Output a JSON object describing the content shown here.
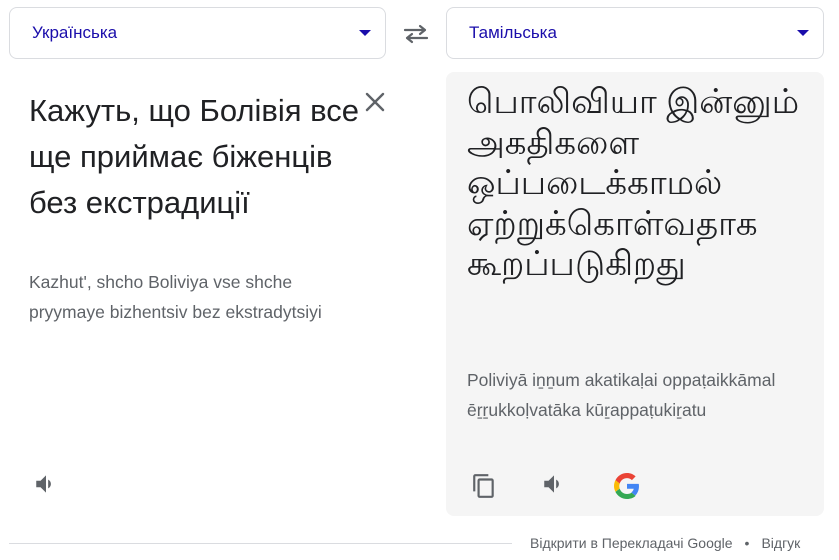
{
  "source_language": {
    "label": "Українська"
  },
  "target_language": {
    "label": "Тамільська"
  },
  "source": {
    "text": "Кажуть, що Болівія все ще приймає біженців без екстрадиції",
    "transliteration": "Kazhut', shcho Boliviya vse shche pryymaye bizhentsiv bez ekstradytsiyi"
  },
  "target": {
    "text": "பொலிவியா இன்னும் அகதிகளை ஒப்படைக்காமல் ஏற்றுக்கொள்வதாக கூறப்படுகிறது",
    "transliteration": "Poliviyā iṉṉum akatikaḷai oppaṭaikkāmal ēṟṟukkoḷvatāka kūṟappaṭukiṟatu"
  },
  "footer": {
    "open_link": "Відкрити в Перекладачі Google",
    "feedback_link": "Відгук",
    "separator": "•"
  },
  "icons": {
    "swap": "swap-arrows-icon",
    "clear": "close-icon",
    "listen": "speaker-icon",
    "copy": "copy-icon",
    "google": "google-logo-icon"
  },
  "colors": {
    "accent": "#1a0dab",
    "text": "#202124",
    "muted": "#5f6368",
    "panel_bg": "#f5f5f5",
    "border": "#dadce0"
  }
}
